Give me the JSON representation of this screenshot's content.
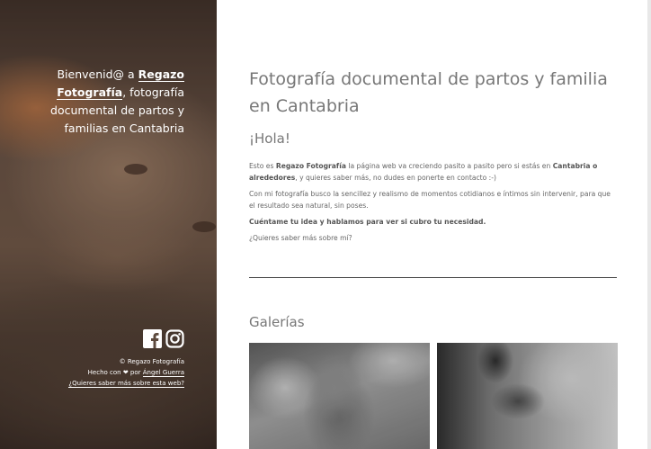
{
  "sidebar": {
    "welcome_prefix": "Bienvenid@ a ",
    "brand": "Regazo Fotografía",
    "welcome_suffix": ", fotografía documental de partos y familias en Cantabria",
    "social": [
      "facebook-icon",
      "instagram-icon"
    ],
    "footer": {
      "copyright": "© Regazo Fotografía",
      "made_with_prefix": "Hecho con ❤ por ",
      "author": "Ángel Guerra",
      "about_link": "¿Quieres saber más sobre esta web?"
    }
  },
  "main": {
    "title": "Fotografía documental de partos y familia en Cantabria",
    "greeting": "¡Hola!",
    "p1_a": "Esto es ",
    "p1_brand": "Regazo Fotografía",
    "p1_b": " la página web va creciendo pasito a pasito pero si estás en ",
    "p1_region": "Cantabria o alrededores",
    "p1_c": ", y quieres saber más, no dudes en ponerte en contacto :-)",
    "p2": "Con mi fotografía busco la sencillez y realismo de momentos cotidianos e íntimos sin intervenir, para que el resultado sea natural, sin poses.",
    "p3": "Cuéntame tu idea y hablamos para ver si cubro tu necesidad.",
    "p4": "¿Quieres saber más sobre mí?",
    "gallery_title": "Galerías"
  },
  "colors": {
    "sidebar_text": "#ffffff",
    "heading": "#777777",
    "divider": "#444444"
  }
}
